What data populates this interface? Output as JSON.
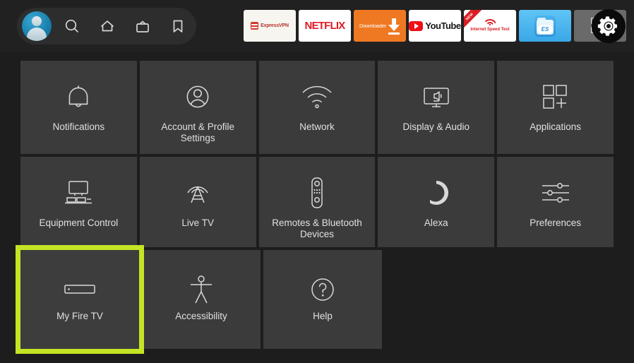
{
  "topbar": {
    "nav": [
      {
        "name": "profile-avatar",
        "label": "Profile"
      },
      {
        "name": "search-icon",
        "label": "Search"
      },
      {
        "name": "home-icon",
        "label": "Home"
      },
      {
        "name": "live-tv-icon",
        "label": "Live TV"
      },
      {
        "name": "bookmark-icon",
        "label": "Watchlist"
      }
    ],
    "apps": [
      {
        "name": "expressvpn",
        "label": "ExpressVPN",
        "bg": "#f7f5f0"
      },
      {
        "name": "netflix",
        "label": "NETFLIX",
        "bg": "#ffffff"
      },
      {
        "name": "downloader",
        "label": "Downloader",
        "bg": "#ef7923"
      },
      {
        "name": "youtube",
        "label": "YouTube",
        "bg": "#ffffff"
      },
      {
        "name": "internet-speed-test",
        "label": "Internet Speed Test",
        "badge": "NEW",
        "bg": "#ffffff"
      },
      {
        "name": "es-file-explorer",
        "label": "ES",
        "bg": "#3aa7e8"
      },
      {
        "name": "app-library",
        "label": "Apps",
        "bg": "#6a6a6a"
      }
    ],
    "settings_label": "Settings"
  },
  "grid": {
    "rows": [
      [
        {
          "id": "notifications",
          "label": "Notifications",
          "icon": "bell-icon"
        },
        {
          "id": "account-profile-settings",
          "label": "Account & Profile Settings",
          "icon": "person-circle-icon"
        },
        {
          "id": "network",
          "label": "Network",
          "icon": "wifi-icon"
        },
        {
          "id": "display-audio",
          "label": "Display & Audio",
          "icon": "tv-speaker-icon"
        },
        {
          "id": "applications",
          "label": "Applications",
          "icon": "apps-grid-icon"
        }
      ],
      [
        {
          "id": "equipment-control",
          "label": "Equipment Control",
          "icon": "tv-equipment-icon"
        },
        {
          "id": "live-tv",
          "label": "Live TV",
          "icon": "broadcast-tower-icon"
        },
        {
          "id": "remotes-bluetooth-devices",
          "label": "Remotes & Bluetooth Devices",
          "icon": "remote-control-icon"
        },
        {
          "id": "alexa",
          "label": "Alexa",
          "icon": "alexa-ring-icon"
        },
        {
          "id": "preferences",
          "label": "Preferences",
          "icon": "sliders-icon"
        }
      ],
      [
        {
          "id": "my-fire-tv",
          "label": "My Fire TV",
          "icon": "fire-tv-stick-icon",
          "focused": true
        },
        {
          "id": "accessibility",
          "label": "Accessibility",
          "icon": "accessibility-person-icon"
        },
        {
          "id": "help",
          "label": "Help",
          "icon": "question-circle-icon"
        }
      ]
    ]
  },
  "colors": {
    "focus_border": "#c4e524",
    "tile_bg": "#3b3b3b",
    "page_bg": "#1d1d1d",
    "topbar_bg": "#212121",
    "label_text": "#e0e0e0"
  }
}
